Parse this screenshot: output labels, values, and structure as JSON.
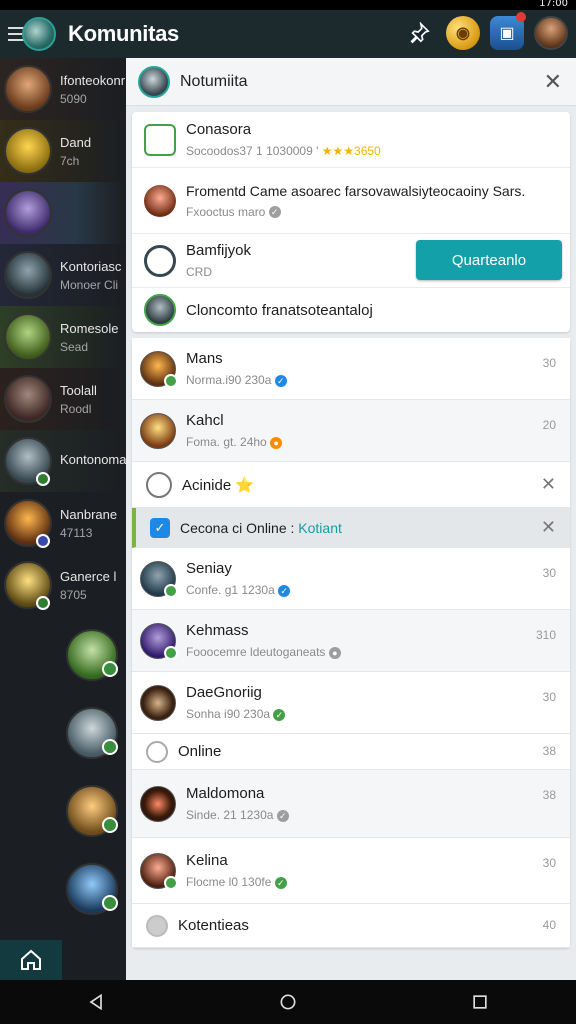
{
  "statusbar": {
    "time": "17:00"
  },
  "appbar": {
    "title": "Komunitas"
  },
  "sidebar": {
    "items": [
      {
        "name": "Ifonteokonr",
        "sub": "5090"
      },
      {
        "name": "Dand",
        "sub": "7ch"
      },
      {
        "name": "",
        "sub": ""
      },
      {
        "name": "Kontoriasc",
        "sub": "Monoer Cli"
      },
      {
        "name": "Romesole",
        "sub": "Sead"
      },
      {
        "name": "Toolall",
        "sub": "Roodl"
      },
      {
        "name": "Kontonomad",
        "sub": ""
      },
      {
        "name": "Nanbrane",
        "sub": "47113"
      },
      {
        "name": "Ganerce l",
        "sub": "8705"
      }
    ]
  },
  "panel": {
    "title": "Notumiita",
    "notifications": [
      {
        "name": "Conasora",
        "sub": "Socoodos37 1 1030009 '",
        "stars": "★★★",
        "score": "3650"
      },
      {
        "name": "Fromentd Came asoarec farsovawalsiyteocaoiny Sars.",
        "sub": "Fxooctus maro"
      },
      {
        "name": "Bamfijyok",
        "sub": "CRD",
        "action": "Quarteanlo"
      },
      {
        "name": "Cloncomto franatsoteantaloj",
        "sub": ""
      }
    ],
    "list": [
      {
        "name": "Mans",
        "sub": "Norma.i90 230a",
        "meta": "30"
      },
      {
        "name": "Kahcl",
        "sub": "Foma. gt. 24ho",
        "meta": "20"
      },
      {
        "name": "Acinide ⭐",
        "sub": "",
        "meta": ""
      },
      {
        "name": "Cecona ci Online : ",
        "highlight": "Kotiant",
        "sub": ""
      },
      {
        "name": "Seniay",
        "sub": "Confe. g1 1230a",
        "meta": "30"
      },
      {
        "name": "Kehmass",
        "sub": "Fooocemre ldeutoganeats",
        "meta": "310"
      },
      {
        "name": "DaeGnoriig",
        "sub": "Sonha i90 230a",
        "meta": "30"
      },
      {
        "name": "Online",
        "sub": "",
        "meta": "38"
      },
      {
        "name": "Maldomona",
        "sub": "Sinde. 21 1230a",
        "meta": "38"
      },
      {
        "name": "Kelina",
        "sub": "Flocme l0 130fe",
        "meta": "30"
      },
      {
        "name": "Kotentieas",
        "sub": "",
        "meta": "40"
      }
    ]
  },
  "colors": {
    "accent": "#14a0a8",
    "appbar": "#1c2a2d",
    "verified": "#1e88e5",
    "online": "#43a047"
  },
  "icons": [
    "menu-icon",
    "pin-icon",
    "coin-icon",
    "chest-icon",
    "close-icon",
    "home-icon",
    "back-icon",
    "circle-home-icon",
    "recents-icon",
    "check-icon",
    "clock-icon"
  ]
}
